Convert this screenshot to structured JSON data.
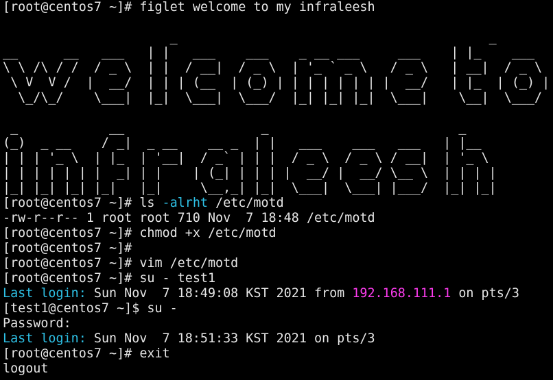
{
  "terminal": {
    "prompt_root": "[root@centos7 ~]# ",
    "prompt_user": "[test1@centos7 ~]$ ",
    "figlet_command": "figlet welcome to my infraleesh",
    "figlet_art": [
      "",
      "                      _                                         _",
      "__      __   ___   | |   ___    ___    _ __ ___     ___    | |_    ___      _ __ ___    _   _",
      "\\ \\ /\\ / /  / _ \\  | |  / __|  / _ \\  | '_ ` _ \\   / _ \\   | __|  / _ \\    | '_ ` _ \\  | | | |",
      " \\ V  V /  |  __/  | | | (__  | (_) | | | | | | | |  __/   | |_  | (_) |   | | | | | | | |_| |",
      "  \\_/\\_/    \\___|  |_|  \\___|  \\___/  |_| |_| |_|  \\___|    \\__|  \\___/    |_| |_| |_|  \\__, |",
      "                                                                                        |___/",
      " _            __                  _                         _",
      "(_)  _ __    / _|  _ __    __ _  | |   ___    ___   ___   | |__",
      "| | | '_ \\  | |_  | '__|  / _` | | |  / _ \\  / _ \\ / __|  | '_ \\",
      "| | | | | | |  _| | |    | (_| | | | |  __/ |  __/ \\__ \\  | | | |",
      "|_| |_| |_| |_|   |_|     \\__,_| |_|  \\___|  \\___| |___/  |_| |_|"
    ],
    "ls_command": "ls ",
    "ls_flag": "-alrht",
    "ls_path": " /etc/motd",
    "ls_output": "-rw-r--r-- 1 root root 710 Nov  7 18:48 /etc/motd",
    "chmod_command": "chmod +x /etc/motd",
    "vim_command": "vim /etc/motd",
    "su_test1_command": "su - test1",
    "last_login_label": "Last login:",
    "last_login_1_time": " Sun Nov  7 18:49:08 KST 2021 from ",
    "last_login_1_ip": "192.168.111.1",
    "last_login_1_tail": " on pts/3",
    "su_root_command": "su -",
    "password_prompt": "Password:",
    "last_login_2_rest": " Sun Nov  7 18:51:33 KST 2021 on pts/3",
    "exit_command": "exit",
    "logout_text": "logout",
    "colors": {
      "background": "#000000",
      "text": "#e6e6e6",
      "accent_cyan": "#2ec1e6",
      "accent_magenta": "#ff3cf0"
    }
  }
}
